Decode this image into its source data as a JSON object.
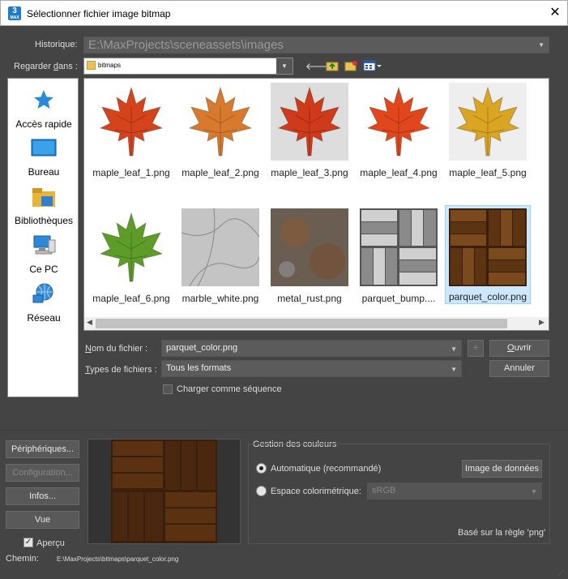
{
  "window": {
    "title": "Sélectionner fichier image bitmap",
    "app_icon": "3",
    "app_icon_sub": "MAX"
  },
  "history": {
    "label": "Historique:",
    "value": "E:\\MaxProjects\\sceneassets\\images"
  },
  "look_in": {
    "label": "Regarder dans :",
    "value": "bitmaps"
  },
  "places": [
    {
      "label": "Accès rapide",
      "icon": "star-icon"
    },
    {
      "label": "Bureau",
      "icon": "desktop-icon"
    },
    {
      "label": "Bibliothèques",
      "icon": "libraries-icon"
    },
    {
      "label": "Ce PC",
      "icon": "computer-icon"
    },
    {
      "label": "Réseau",
      "icon": "network-icon"
    }
  ],
  "files": [
    {
      "name": "maple_leaf_1.png",
      "kind": "leaf",
      "color": "#d5431c"
    },
    {
      "name": "maple_leaf_2.png",
      "kind": "leaf",
      "color": "#d87a2e"
    },
    {
      "name": "maple_leaf_3.png",
      "kind": "leaf",
      "color": "#cf3a1a"
    },
    {
      "name": "maple_leaf_4.png",
      "kind": "leaf",
      "color": "#e2461c"
    },
    {
      "name": "maple_leaf_5.png",
      "kind": "leaf",
      "color": "#d9a522"
    },
    {
      "name": "maple_leaf_6.png",
      "kind": "leaf",
      "color": "#5e9c2a"
    },
    {
      "name": "marble_white.png",
      "kind": "marble",
      "color": "#c4c4c4"
    },
    {
      "name": "metal_rust.png",
      "kind": "rust",
      "color": "#6a5d52"
    },
    {
      "name": "parquet_bump....",
      "kind": "parquet_bw",
      "color": "#9a9a9a"
    },
    {
      "name": "parquet_color.png",
      "kind": "parquet",
      "color": "#6b3f18",
      "selected": true
    }
  ],
  "filename": {
    "label": "Nom du fichier :",
    "value": "parquet_color.png"
  },
  "filetype": {
    "label": "Types de fichiers :",
    "value": "Tous les formats"
  },
  "buttons": {
    "open": "Ouvrir",
    "cancel": "Annuler",
    "plus": "+"
  },
  "sequence": {
    "label": "Charger comme séquence",
    "checked": false
  },
  "left_buttons": {
    "devices": "Périphériques...",
    "config": "Configuration...",
    "info": "Infos...",
    "view": "Vue"
  },
  "apercu": {
    "label": "Aperçu",
    "checked": true
  },
  "path": {
    "label": "Chemin:",
    "value": "E:\\MaxProjects\\bitmaps\\parquet_color.png"
  },
  "color_mgmt": {
    "title": "Gestion des couleurs",
    "auto": "Automatique (recommandé)",
    "data_image": "Image de données",
    "space": "Espace colorimétrique:",
    "space_value": "sRGB",
    "rule": "Basé sur la règle 'png'"
  }
}
